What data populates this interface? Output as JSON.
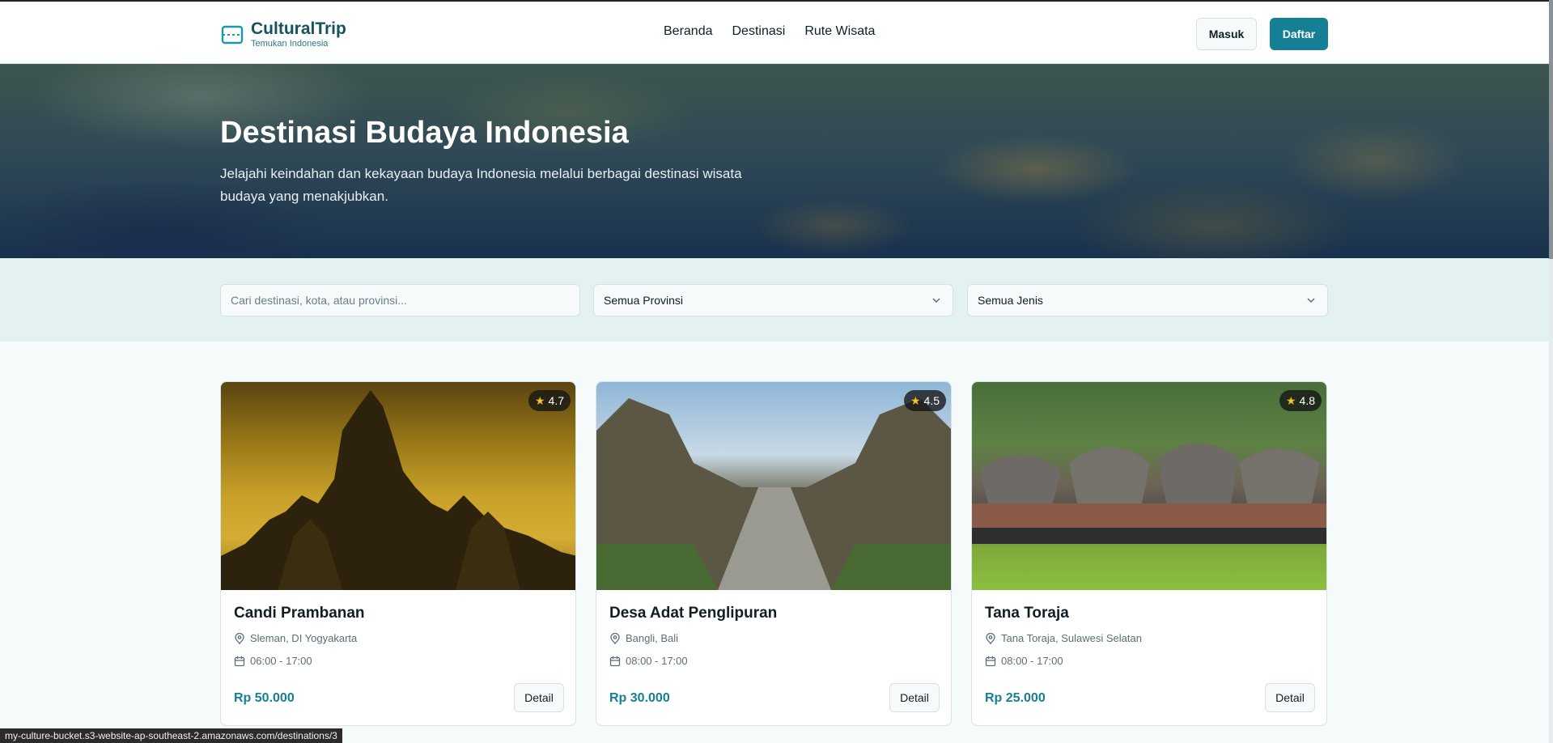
{
  "brand": {
    "name": "CulturalTrip",
    "tagline": "Temukan Indonesia"
  },
  "nav": {
    "items": [
      "Beranda",
      "Destinasi",
      "Rute Wisata"
    ]
  },
  "auth": {
    "login": "Masuk",
    "register": "Daftar"
  },
  "hero": {
    "title": "Destinasi Budaya Indonesia",
    "subtitle": "Jelajahi keindahan dan kekayaan budaya Indonesia melalui berbagai destinasi wisata budaya yang menakjubkan."
  },
  "filters": {
    "search_placeholder": "Cari destinasi, kota, atau provinsi...",
    "province_selected": "Semua Provinsi",
    "type_selected": "Semua Jenis"
  },
  "cards": [
    {
      "name": "Candi Prambanan",
      "rating": "4.7",
      "location": "Sleman, DI Yogyakarta",
      "hours": "06:00 - 17:00",
      "price": "Rp 50.000",
      "action": "Detail"
    },
    {
      "name": "Desa Adat Penglipuran",
      "rating": "4.5",
      "location": "Bangli, Bali",
      "hours": "08:00 - 17:00",
      "price": "Rp 30.000",
      "action": "Detail"
    },
    {
      "name": "Tana Toraja",
      "rating": "4.8",
      "location": "Tana Toraja, Sulawesi Selatan",
      "hours": "08:00 - 17:00",
      "price": "Rp 25.000",
      "action": "Detail"
    }
  ],
  "status_url": "my-culture-bucket.s3-website-ap-southeast-2.amazonaws.com/destinations/3",
  "colors": {
    "accent": "#157f95",
    "brand": "#15525f",
    "star": "#f6c21c"
  }
}
